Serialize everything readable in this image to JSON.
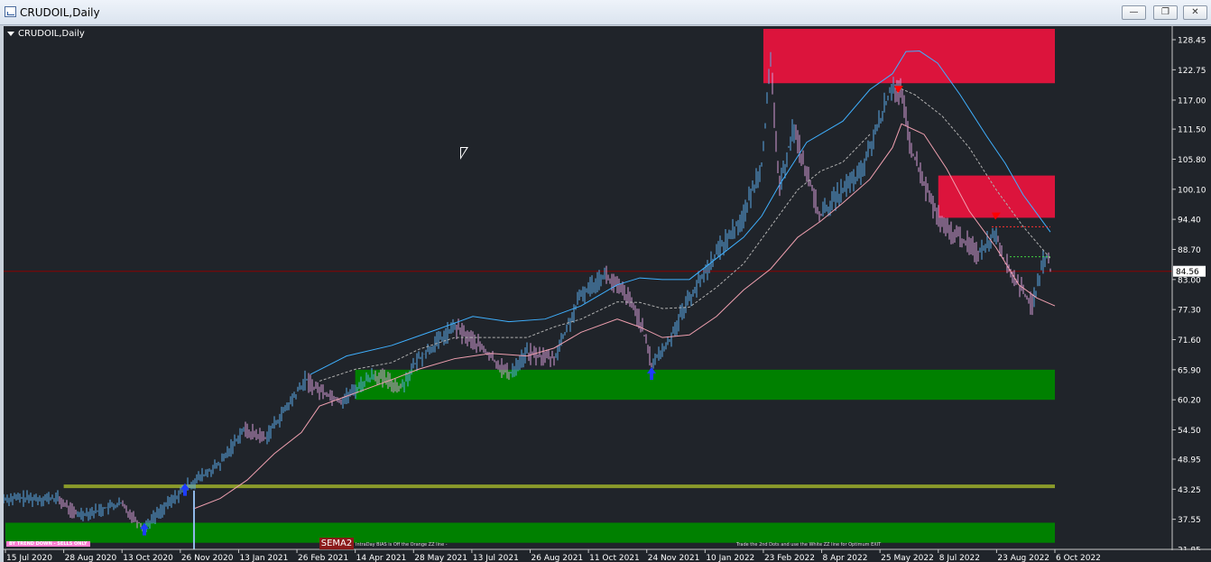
{
  "window": {
    "title": "CRUDOIL,Daily",
    "minimize": "—",
    "maximize": "❐",
    "close": "✕"
  },
  "chart_label": "CRUDOIL,Daily",
  "notes": {
    "trend_label": "BY TREND DOWN - SELLS ONLY",
    "sema": "SEMA2",
    "bias_note": "IntraDay BIAS is Off the Orange ZZ line -",
    "exit_note": "Trade the 2nd Dots and use the White ZZ line for Optimum EXIT"
  },
  "colors": {
    "background": "#20242a",
    "up_bar": "#5aa9e6",
    "down_bar": "#d49bd6",
    "supply_zone": "#dc143c",
    "demand_zone": "#008000",
    "level_line": "#8a9a2a",
    "upper_band": "#3fb0ff",
    "lower_band": "#f0a0b0",
    "mid_band": "#b0b0b0",
    "current_price_line": "#8b0000",
    "buy_arrow": "#1e3cff",
    "sell_arrow": "#ff0000"
  },
  "chart_data": {
    "type": "candlestick",
    "symbol": "CRUDOIL",
    "timeframe": "Daily",
    "ylim": [
      31.85,
      130.5
    ],
    "y_ticks": [
      "128.45",
      "122.75",
      "117.00",
      "111.50",
      "105.80",
      "100.10",
      "94.40",
      "88.70",
      "83.00",
      "77.30",
      "71.60",
      "65.90",
      "60.20",
      "54.50",
      "48.95",
      "43.25",
      "37.55",
      "31.85"
    ],
    "x_ticks": [
      "15 Jul 2020",
      "28 Aug 2020",
      "13 Oct 2020",
      "26 Nov 2020",
      "13 Jan 2021",
      "26 Feb 2021",
      "14 Apr 2021",
      "28 May 2021",
      "13 Jul 2021",
      "26 Aug 2021",
      "11 Oct 2021",
      "24 Nov 2021",
      "10 Jan 2022",
      "23 Feb 2022",
      "8 Apr 2022",
      "25 May 2022",
      "8 Jul 2022",
      "23 Aug 2022",
      "6 Oct 2022"
    ],
    "current_price": "84.56",
    "current_price_value": 84.56,
    "price_path": [
      [
        0,
        41.5
      ],
      [
        60,
        41.5
      ],
      [
        80,
        38.5
      ],
      [
        100,
        39
      ],
      [
        130,
        40.5
      ],
      [
        155,
        36
      ],
      [
        170,
        38.5
      ],
      [
        205,
        44
      ],
      [
        240,
        48
      ],
      [
        265,
        54.5
      ],
      [
        290,
        53
      ],
      [
        315,
        59
      ],
      [
        335,
        64
      ],
      [
        345,
        62.5
      ],
      [
        375,
        60
      ],
      [
        410,
        65
      ],
      [
        440,
        62.5
      ],
      [
        460,
        68
      ],
      [
        500,
        74
      ],
      [
        530,
        70
      ],
      [
        560,
        65
      ],
      [
        580,
        69
      ],
      [
        610,
        68
      ],
      [
        640,
        80
      ],
      [
        665,
        84
      ],
      [
        690,
        80
      ],
      [
        705,
        75.5
      ],
      [
        718,
        67
      ],
      [
        735,
        70.5
      ],
      [
        755,
        78
      ],
      [
        790,
        88
      ],
      [
        820,
        95
      ],
      [
        840,
        105
      ],
      [
        850,
        124
      ],
      [
        860,
        100
      ],
      [
        875,
        112
      ],
      [
        890,
        103
      ],
      [
        905,
        95
      ],
      [
        930,
        100
      ],
      [
        950,
        103
      ],
      [
        975,
        115
      ],
      [
        985,
        120
      ],
      [
        995,
        118
      ],
      [
        1005,
        108
      ],
      [
        1025,
        99
      ],
      [
        1040,
        93
      ],
      [
        1060,
        91
      ],
      [
        1080,
        88
      ],
      [
        1100,
        92
      ],
      [
        1110,
        86
      ],
      [
        1125,
        82
      ],
      [
        1140,
        78
      ],
      [
        1150,
        85
      ],
      [
        1155,
        88
      ],
      [
        1160,
        85
      ]
    ],
    "zones": [
      {
        "kind": "supply",
        "from_x": "23 Feb 2022",
        "to_x": "6 Oct 2022",
        "y_top": 130.5,
        "y_bottom": 120.2
      },
      {
        "kind": "supply",
        "from_x": "8 Jul 2022",
        "to_x": "6 Oct 2022",
        "y_top": 102.7,
        "y_bottom": 94.7
      },
      {
        "kind": "demand",
        "from_x": "14 Apr 2021",
        "to_x": "6 Oct 2022",
        "y_top": 65.9,
        "y_bottom": 60.2
      },
      {
        "kind": "demand",
        "from_x": "15 Jul 2020",
        "to_x": "6 Oct 2022",
        "y_top": 36.9,
        "y_bottom": 33.1
      }
    ],
    "level_lines": [
      {
        "y": 43.8,
        "from_x": "28 Aug 2020",
        "to_x": "6 Oct 2022"
      }
    ],
    "upper_band": [
      [
        340,
        65
      ],
      [
        380,
        68.5
      ],
      [
        430,
        70.5
      ],
      [
        480,
        73.5
      ],
      [
        520,
        76
      ],
      [
        560,
        75
      ],
      [
        600,
        75.5
      ],
      [
        640,
        78
      ],
      [
        680,
        82
      ],
      [
        705,
        83.3
      ],
      [
        730,
        83
      ],
      [
        760,
        83
      ],
      [
        790,
        87
      ],
      [
        820,
        91
      ],
      [
        840,
        95
      ],
      [
        860,
        101
      ],
      [
        890,
        109
      ],
      [
        930,
        113
      ],
      [
        960,
        119
      ],
      [
        985,
        122
      ],
      [
        1000,
        126.2
      ],
      [
        1015,
        126.3
      ],
      [
        1035,
        124
      ],
      [
        1060,
        118
      ],
      [
        1090,
        110
      ],
      [
        1110,
        105
      ],
      [
        1130,
        99
      ],
      [
        1160,
        92
      ]
    ],
    "lower_band": [
      [
        210,
        39.5
      ],
      [
        240,
        41.5
      ],
      [
        270,
        45
      ],
      [
        300,
        50
      ],
      [
        330,
        54
      ],
      [
        350,
        59
      ],
      [
        390,
        61.5
      ],
      [
        430,
        64
      ],
      [
        460,
        66
      ],
      [
        500,
        68
      ],
      [
        540,
        69
      ],
      [
        580,
        68.5
      ],
      [
        610,
        70
      ],
      [
        640,
        73
      ],
      [
        680,
        75.5
      ],
      [
        705,
        74
      ],
      [
        730,
        72
      ],
      [
        760,
        72.5
      ],
      [
        790,
        76
      ],
      [
        820,
        81
      ],
      [
        850,
        85
      ],
      [
        880,
        91
      ],
      [
        905,
        94
      ],
      [
        930,
        97.5
      ],
      [
        960,
        102
      ],
      [
        985,
        108
      ],
      [
        995,
        112.5
      ],
      [
        1020,
        110.5
      ],
      [
        1045,
        104
      ],
      [
        1070,
        96
      ],
      [
        1100,
        89
      ],
      [
        1125,
        82
      ],
      [
        1145,
        79.5
      ],
      [
        1165,
        78
      ]
    ],
    "mid_band": [
      [
        990,
        119.5
      ],
      [
        1010,
        118
      ],
      [
        1040,
        114
      ],
      [
        1070,
        108
      ],
      [
        1100,
        100
      ],
      [
        1130,
        93
      ],
      [
        1160,
        87
      ]
    ],
    "buy_arrows": [
      {
        "x": 156,
        "y": 34.5
      },
      {
        "x": 201,
        "y": 42
      },
      {
        "x": 718,
        "y": 64
      }
    ],
    "sell_arrows": [
      {
        "x": 993,
        "y": 119
      },
      {
        "x": 1101,
        "y": 95
      }
    ],
    "dotted_levels": [
      {
        "y": 93.0,
        "from_x": 1095,
        "to_x": 1160
      },
      {
        "y": 87.3,
        "from_x": 1115,
        "to_x": 1160
      }
    ]
  }
}
